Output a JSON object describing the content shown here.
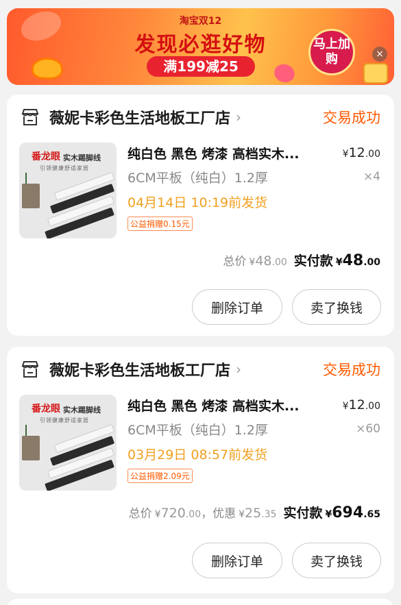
{
  "banner": {
    "brand": "淘宝双12",
    "title": "发现必逛好物",
    "promo": "满199减25",
    "cta": "马上加购",
    "close": "×"
  },
  "orders": [
    {
      "shop_name": "薇妮卡彩色生活地板工厂店",
      "status": "交易成功",
      "thumb_brand": "番龙眼",
      "thumb_sub": "实木踢脚线",
      "thumb_tag": "引领健康舒适家居",
      "title": "纯白色 黑色 烤漆 高档实木...",
      "spec": "6CM平板（纯白）1.2厚",
      "ship": "04月14日 10:19前发货",
      "donate": "公益捐赠0.15元",
      "price_int": "12",
      "price_dec": ".00",
      "qty": "×4",
      "total_label": "总价",
      "total_int": "48",
      "total_dec": ".00",
      "paid_label": "实付款",
      "paid_int": "48",
      "paid_dec": ".00",
      "btn_delete": "删除订单",
      "btn_sell": "卖了换钱"
    },
    {
      "shop_name": "薇妮卡彩色生活地板工厂店",
      "status": "交易成功",
      "thumb_brand": "番龙眼",
      "thumb_sub": "实木踢脚线",
      "thumb_tag": "引领健康舒适家居",
      "title": "纯白色 黑色 烤漆 高档实木...",
      "spec": "6CM平板（纯白）1.2厚",
      "ship": "03月29日 08:57前发货",
      "donate": "公益捐赠2.09元",
      "price_int": "12",
      "price_dec": ".00",
      "qty": "×60",
      "total_label": "总价",
      "total_int": "720",
      "total_dec": ".00",
      "discount_label": "，优惠",
      "discount_int": "25",
      "discount_dec": ".35",
      "paid_label": "实付款",
      "paid_int": "694",
      "paid_dec": ".65",
      "btn_delete": "删除订单",
      "btn_sell": "卖了换钱"
    }
  ],
  "currency": "¥"
}
